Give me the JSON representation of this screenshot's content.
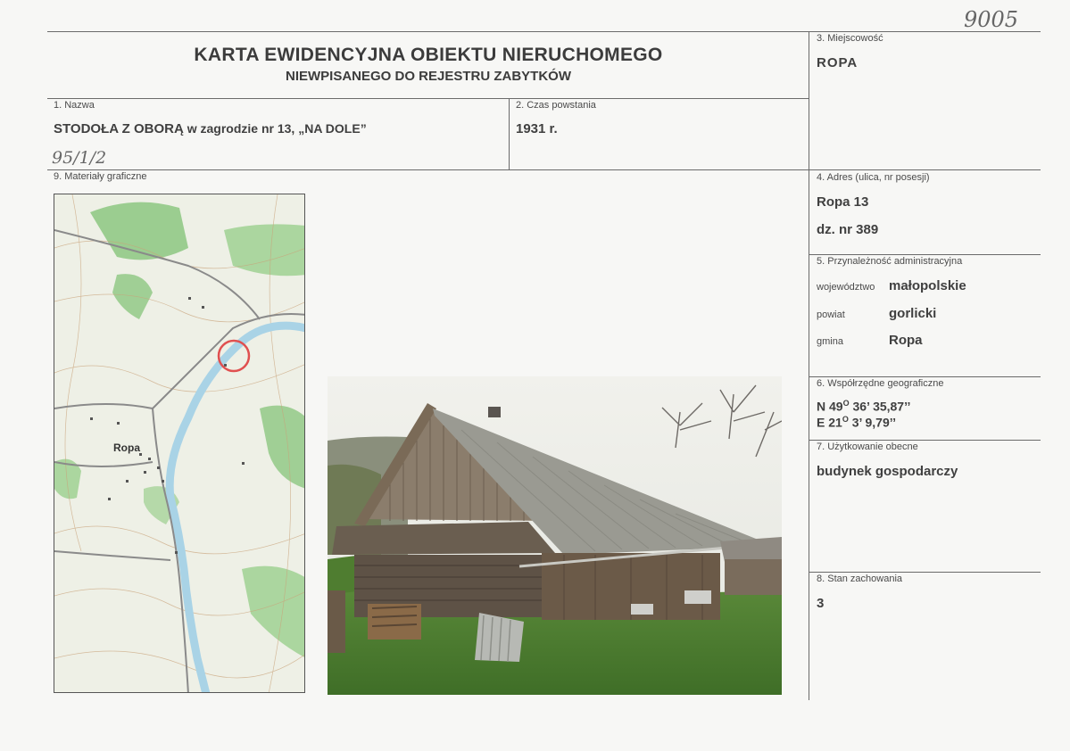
{
  "handwritten": {
    "number": "9005",
    "note": "95/1/2"
  },
  "header": {
    "title": "KARTA EWIDENCYJNA OBIEKTU NIERUCHOMEGO",
    "subtitle": "NIEWPISANEGO DO REJESTRU ZABYTKÓW"
  },
  "fields": {
    "f1_label": "1. Nazwa",
    "f1_value_bold": "STODOŁA Z OBORĄ",
    "f1_value_rest": " w zagrodzie nr 13, „NA DOLE”",
    "f2_label": "2. Czas powstania",
    "f2_value": "1931 r.",
    "f3_label": "3. Miejscowość",
    "f3_value": "ROPA",
    "f4_label": "4. Adres (ulica, nr posesji)",
    "f4_value1": "Ropa 13",
    "f4_value2": "dz. nr 389",
    "f5_label": "5. Przynależność administracyjna",
    "f5_woj_label": "województwo",
    "f5_woj_value": "małopolskie",
    "f5_pow_label": "powiat",
    "f5_pow_value": "gorlicki",
    "f5_gmi_label": "gmina",
    "f5_gmi_value": "Ropa",
    "f6_label": "6. Współrzędne geograficzne",
    "f6_n_prefix": "N 49",
    "f6_n_suffix": " 36’ 35,87’’",
    "f6_e_prefix": "E 21",
    "f6_e_suffix": " 3’ 9,79’’",
    "degree": "O",
    "f7_label": "7. Użytkowanie obecne",
    "f7_value": "budynek gospodarczy",
    "f8_label": "8. Stan zachowania",
    "f8_value": "3",
    "f9_label": "9. Materiały graficzne"
  },
  "map_labels": {
    "town": "Ropa"
  },
  "colors": {
    "line": "#6a6a6a",
    "map_green": "#7fbf6a",
    "map_water": "#a9d3e6",
    "marker": "#e05050"
  }
}
